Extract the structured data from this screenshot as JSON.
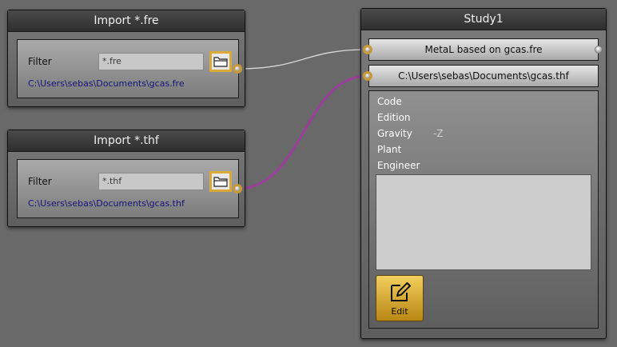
{
  "nodes": {
    "import_fre": {
      "title": "Import *.fre",
      "filter_label": "Filter",
      "filter_value": "*.fre",
      "path": "C:\\Users\\sebas\\Documents\\gcas.fre",
      "browse_icon": "folder-open-icon"
    },
    "import_thf": {
      "title": "Import *.thf",
      "filter_label": "Filter",
      "filter_value": "*.thf",
      "path": "C:\\Users\\sebas\\Documents\\gcas.thf",
      "browse_icon": "folder-open-icon"
    },
    "study": {
      "title": "Study1",
      "input_1": "MetaL based on gcas.fre",
      "input_2": "C:\\Users\\sebas\\Documents\\gcas.thf",
      "properties": [
        {
          "label": "Code",
          "value": ""
        },
        {
          "label": "Edition",
          "value": ""
        },
        {
          "label": "Gravity",
          "value": "-Z"
        },
        {
          "label": "Plant",
          "value": ""
        },
        {
          "label": "Engineer",
          "value": ""
        }
      ],
      "edit_label": "Edit",
      "edit_icon": "pencil-edit-icon"
    }
  },
  "wires": {
    "fre_wire_color": "#d8d8d8",
    "thf_wire_color": "#9a3f9a"
  },
  "colors": {
    "canvas": "#696969",
    "port_accent": "#c79a37",
    "edit_button": "#e2b53e",
    "path_text": "#14147a"
  }
}
